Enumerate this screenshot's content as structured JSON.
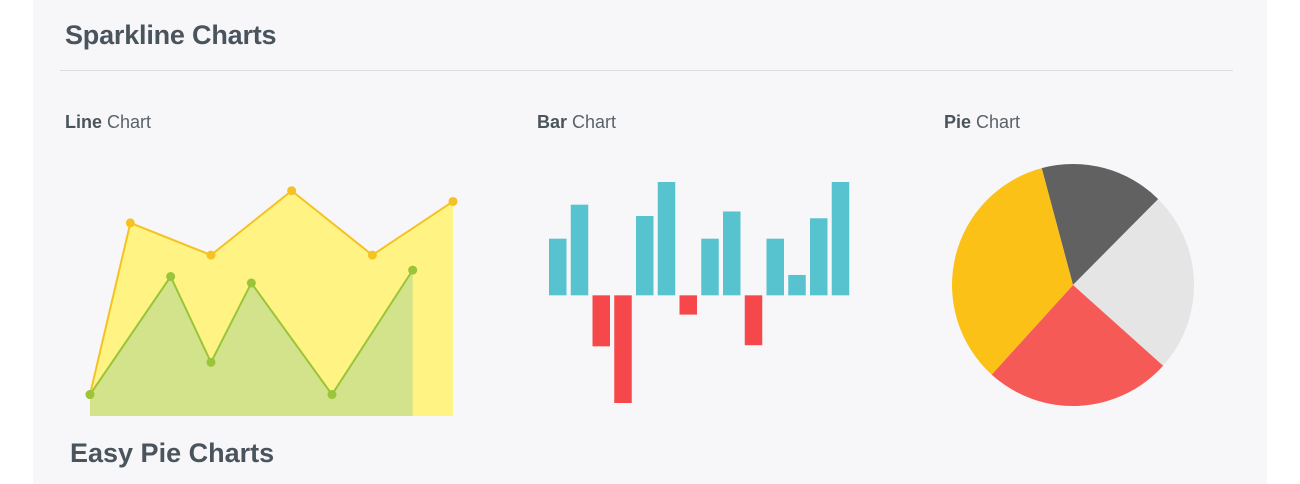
{
  "sparkline": {
    "title": "Sparkline Charts"
  },
  "easy_pie": {
    "title": "Easy Pie Charts"
  },
  "labels": {
    "line_bold": "Line",
    "line_rest": "Chart",
    "bar_bold": "Bar",
    "bar_rest": "Chart",
    "pie_bold": "Pie",
    "pie_rest": "Chart"
  },
  "colors": {
    "line_yellow": "#f5c223",
    "area_yellow": "#fff383",
    "line_green": "#9ac43a",
    "area_green": "#d2e38b",
    "bar_positive": "#57c3cf",
    "bar_negative": "#f6484b",
    "pie_dark": "#616161",
    "pie_light": "#e5e5e5",
    "pie_red": "#f55a56",
    "pie_yellow": "#fcc117"
  },
  "chart_data": [
    {
      "type": "area",
      "title": "Line Chart",
      "x": [
        0,
        1,
        2,
        3,
        4,
        5,
        6,
        7,
        8,
        9
      ],
      "series": [
        {
          "values": [
            1,
            9,
            null,
            7.5,
            null,
            10.5,
            null,
            7.5,
            null,
            10
          ]
        },
        {
          "values": [
            1,
            null,
            6.5,
            2.5,
            6.2,
            null,
            1,
            null,
            6.8,
            null
          ]
        }
      ],
      "ylim": [
        0,
        11
      ]
    },
    {
      "type": "bar",
      "title": "Bar Chart",
      "values": [
        5,
        8,
        -4.5,
        -9.5,
        7,
        10,
        -1.7,
        5,
        7.4,
        -4.4,
        5,
        1.8,
        6.8,
        10
      ],
      "ylim": [
        -9.5,
        10
      ]
    },
    {
      "type": "pie",
      "title": "Pie Chart",
      "categories": [
        "dark",
        "light",
        "red",
        "yellow"
      ],
      "values": [
        16.6,
        24.2,
        25.1,
        34.1
      ]
    }
  ]
}
